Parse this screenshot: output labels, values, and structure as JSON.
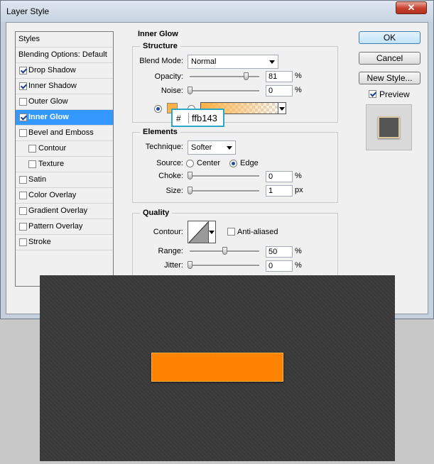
{
  "window": {
    "title": "Layer Style",
    "close_glyph": "✕"
  },
  "styles_list": {
    "items": [
      {
        "label": "Styles",
        "checkbox": false,
        "checked": false,
        "selected": false,
        "sub": false
      },
      {
        "label": "Blending Options: Default",
        "checkbox": false,
        "checked": false,
        "selected": false,
        "sub": false
      },
      {
        "label": "Drop Shadow",
        "checkbox": true,
        "checked": true,
        "selected": false,
        "sub": false
      },
      {
        "label": "Inner Shadow",
        "checkbox": true,
        "checked": true,
        "selected": false,
        "sub": false
      },
      {
        "label": "Outer Glow",
        "checkbox": true,
        "checked": false,
        "selected": false,
        "sub": false
      },
      {
        "label": "Inner Glow",
        "checkbox": true,
        "checked": true,
        "selected": true,
        "sub": false
      },
      {
        "label": "Bevel and Emboss",
        "checkbox": true,
        "checked": false,
        "selected": false,
        "sub": false
      },
      {
        "label": "Contour",
        "checkbox": true,
        "checked": false,
        "selected": false,
        "sub": true
      },
      {
        "label": "Texture",
        "checkbox": true,
        "checked": false,
        "selected": false,
        "sub": true
      },
      {
        "label": "Satin",
        "checkbox": true,
        "checked": false,
        "selected": false,
        "sub": false
      },
      {
        "label": "Color Overlay",
        "checkbox": true,
        "checked": false,
        "selected": false,
        "sub": false
      },
      {
        "label": "Gradient Overlay",
        "checkbox": true,
        "checked": false,
        "selected": false,
        "sub": false
      },
      {
        "label": "Pattern Overlay",
        "checkbox": true,
        "checked": false,
        "selected": false,
        "sub": false
      },
      {
        "label": "Stroke",
        "checkbox": true,
        "checked": false,
        "selected": false,
        "sub": false
      }
    ]
  },
  "inner_glow": {
    "title": "Inner Glow",
    "structure": {
      "title": "Structure",
      "blend_mode_label": "Blend Mode:",
      "blend_mode_value": "Normal",
      "opacity_label": "Opacity:",
      "opacity_value": "81",
      "opacity_percent": 81,
      "noise_label": "Noise:",
      "noise_value": "0",
      "noise_percent": 0,
      "percent_unit": "%",
      "color_swatch": "#ffb143",
      "hex_prefix": "#",
      "hex_value": "ffb143"
    },
    "elements": {
      "title": "Elements",
      "technique_label": "Technique:",
      "technique_value": "Softer",
      "source_label": "Source:",
      "source_center": "Center",
      "source_edge": "Edge",
      "choke_label": "Choke:",
      "choke_value": "0",
      "choke_percent": 0,
      "size_label": "Size:",
      "size_value": "1",
      "size_unit": "px",
      "percent_unit": "%"
    },
    "quality": {
      "title": "Quality",
      "contour_label": "Contour:",
      "anti_aliased_label": "Anti-aliased",
      "range_label": "Range:",
      "range_value": "50",
      "range_percent": 50,
      "jitter_label": "Jitter:",
      "jitter_value": "0",
      "jitter_percent": 0,
      "percent_unit": "%"
    }
  },
  "buttons": {
    "ok": "OK",
    "cancel": "Cancel",
    "new_style": "New Style...",
    "preview": "Preview"
  },
  "colors": {
    "selection": "#3399ff",
    "artwork_bg": "#3a3a3a",
    "artwork_button": "#ff8200",
    "glow": "#ffb143"
  }
}
